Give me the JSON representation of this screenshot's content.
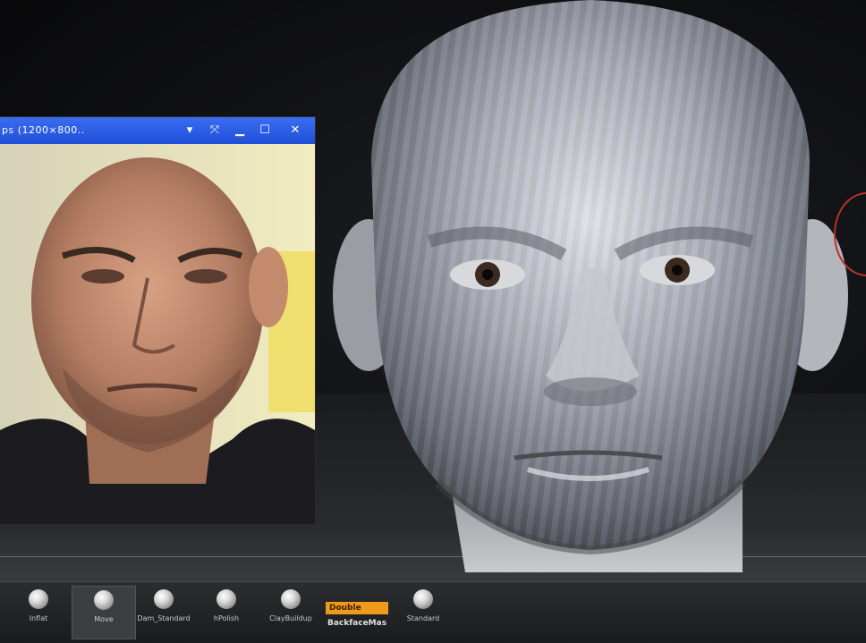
{
  "reference_window": {
    "title": "ps (1200×800..",
    "buttons": [
      "dropdown",
      "fit",
      "minimize",
      "maximize",
      "close"
    ]
  },
  "brush_shelf": {
    "brushes": [
      {
        "label": "Inflat"
      },
      {
        "label": "Move",
        "active": true
      },
      {
        "label": "Dam_Standard"
      },
      {
        "label": "hPolish"
      },
      {
        "label": "ClayBuildup"
      },
      {
        "label": "Standard"
      }
    ],
    "double_toggle": "Double",
    "backface_label": "BackfaceMas"
  },
  "icons": {
    "dropdown": "triangle-down-icon",
    "fit": "expand-arrows-icon",
    "minimize": "minimize-icon",
    "maximize": "maximize-icon",
    "close": "close-icon"
  },
  "colors": {
    "titlebar": "#2a5ae6",
    "accent_orange": "#f09a1a",
    "gizmo_red": "#b8322c"
  }
}
